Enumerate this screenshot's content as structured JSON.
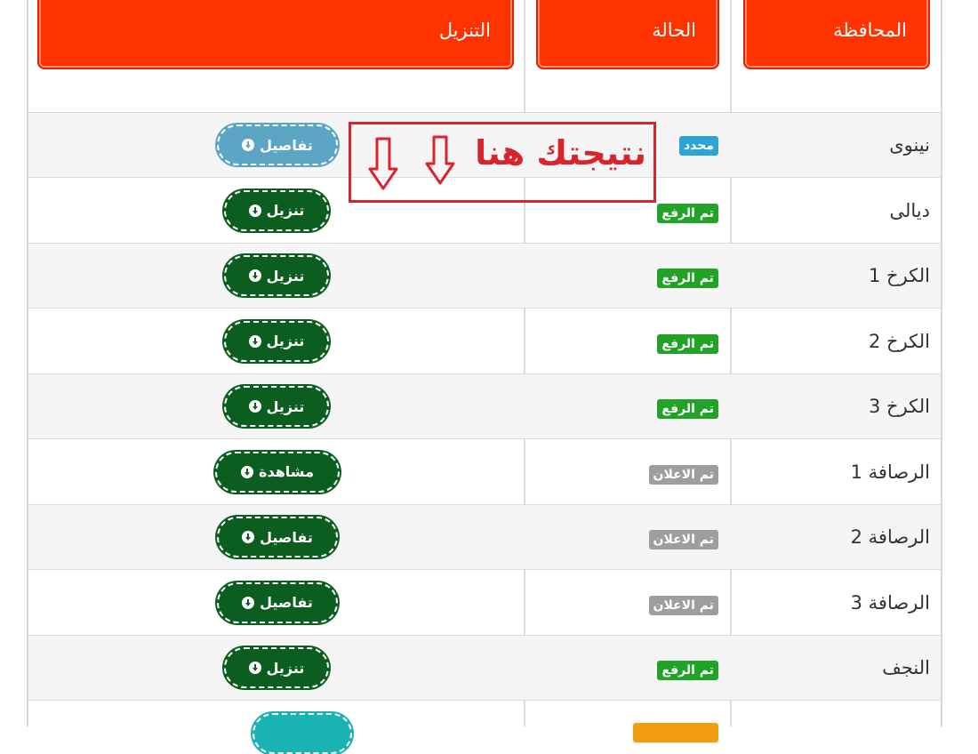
{
  "header": {
    "governorate": "المحافظة",
    "status": "الحالة",
    "download": "التنزيل"
  },
  "rows": [
    {
      "governorate": "نينوى",
      "status": "محدد",
      "status_color": "#2ea4d6",
      "action": "تفاصيل",
      "action_color": "#5ba6c4"
    },
    {
      "governorate": "ديالى",
      "status": "تم الرفع",
      "status_color": "#21a327",
      "action": "تنزيل",
      "action_color": "#0b5e1f"
    },
    {
      "governorate": "الكرخ 1",
      "status": "تم الرفع",
      "status_color": "#21a327",
      "action": "تنزيل",
      "action_color": "#0b5e1f"
    },
    {
      "governorate": "الكرخ 2",
      "status": "تم الرفع",
      "status_color": "#21a327",
      "action": "تنزيل",
      "action_color": "#0b5e1f"
    },
    {
      "governorate": "الكرخ 3",
      "status": "تم الرفع",
      "status_color": "#21a327",
      "action": "تنزيل",
      "action_color": "#0b5e1f"
    },
    {
      "governorate": "الرصافة 1",
      "status": "تم الاعلان",
      "status_color": "#9e9e9e",
      "action": "مشاهدة",
      "action_color": "#0b5e1f"
    },
    {
      "governorate": "الرصافة 2",
      "status": "تم الاعلان",
      "status_color": "#9e9e9e",
      "action": "تفاصيل",
      "action_color": "#0b5e1f"
    },
    {
      "governorate": "الرصافة 3",
      "status": "تم الاعلان",
      "status_color": "#9e9e9e",
      "action": "تفاصيل",
      "action_color": "#0b5e1f"
    },
    {
      "governorate": "النجف",
      "status": "تم الرفع",
      "status_color": "#21a327",
      "action": "تنزيل",
      "action_color": "#0b5e1f"
    }
  ],
  "overlay": {
    "text": "نتيجتك هنا",
    "color": "#d9232d"
  },
  "colors": {
    "header_red": "#ff3300",
    "partial_badge": "#f39c12",
    "partial_button": "#1ab3b3"
  }
}
